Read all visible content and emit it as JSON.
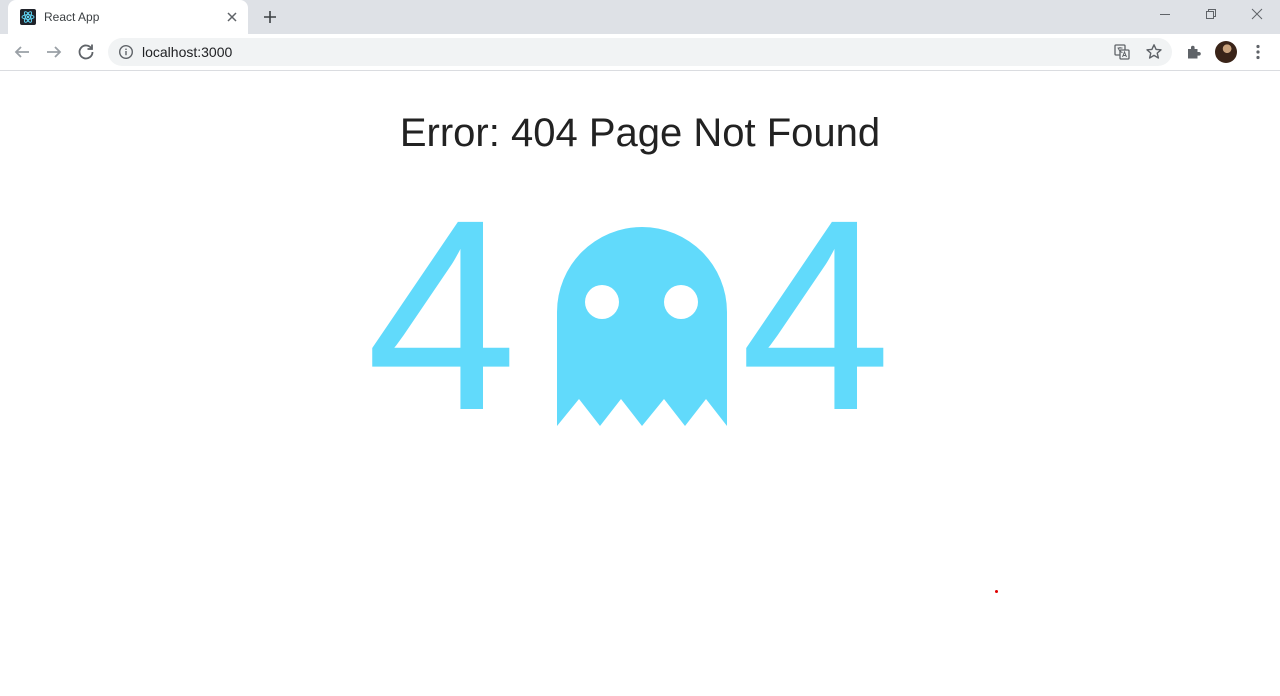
{
  "browser": {
    "tab": {
      "title": "React App",
      "favicon": "react-icon"
    },
    "url": "localhost:3000",
    "colors": {
      "tabstrip": "#dee1e6",
      "omnibox": "#f1f3f4"
    }
  },
  "page": {
    "heading": "Error: 404 Page Not Found",
    "digits": {
      "left": "4",
      "right": "4"
    },
    "ghost_icon": "ghost-icon",
    "accent_color": "#61dafb"
  }
}
